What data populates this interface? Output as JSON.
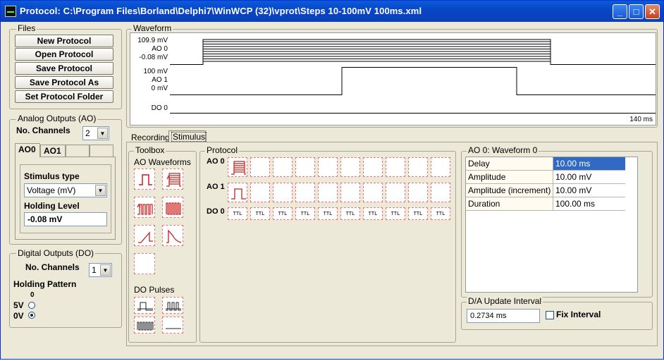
{
  "title": "Protocol: C:\\Program Files\\Borland\\Delphi7\\WinWCP (32)\\vprot\\Steps 10-100mV 100ms.xml",
  "window_buttons": {
    "minimize": "_",
    "maximize": "□",
    "close": "✕"
  },
  "files": {
    "legend": "Files",
    "buttons": [
      "New Protocol",
      "Open Protocol",
      "Save Protocol",
      "Save Protocol As",
      "Set Protocol Folder"
    ]
  },
  "analog": {
    "legend": "Analog Outputs (AO)",
    "nchannels_label": "No. Channels",
    "nchannels_value": "2",
    "tabs": [
      "AO0",
      "AO1",
      "",
      ""
    ],
    "stimulus_type_label": "Stimulus type",
    "stimulus_type_value": "Voltage (mV)",
    "holding_label": "Holding Level",
    "holding_value": "-0.08 mV"
  },
  "digital": {
    "legend": "Digital Outputs (DO)",
    "nchannels_label": "No. Channels",
    "nchannels_value": "1",
    "holding_label": "Holding Pattern",
    "bit_label": "0",
    "high_label": "5V",
    "low_label": "0V",
    "selected": "0V"
  },
  "waveform": {
    "legend": "Waveform",
    "ao0_labels": [
      "109.9 mV",
      "AO 0",
      "-0.08 mV"
    ],
    "ao1_labels": [
      "100 mV",
      "AO 1",
      "0 mV"
    ],
    "do0_label": "DO 0",
    "time_label": "140 ms"
  },
  "page_tabs": {
    "recording": "Recording",
    "stimulus": "Stimulus"
  },
  "toolbox": {
    "legend": "Toolbox",
    "ao_title": "AO Waveforms",
    "do_title": "DO Pulses",
    "ao_icons": [
      "step-pulse-icon",
      "step-family-icon",
      "pulse-train-icon",
      "pulse-train-dense-icon",
      "ramp-icon",
      "ap-waveform-icon",
      "blank-waveform-icon"
    ],
    "do_icons": [
      "ttl-pulse-icon",
      "ttl-train-icon",
      "ttl-dense-train-icon",
      "ttl-blank-icon"
    ]
  },
  "protocol": {
    "legend": "Protocol",
    "rows": [
      "AO 0",
      "AO 1",
      "DO 0"
    ],
    "ttl_text": "TTL"
  },
  "properties": {
    "legend": "AO 0: Waveform 0",
    "rows": [
      {
        "key": "Delay",
        "value": "10.00 ms"
      },
      {
        "key": "Amplitude",
        "value": "10.00 mV"
      },
      {
        "key": "Amplitude (increment)",
        "value": "10.00 mV"
      },
      {
        "key": "Duration",
        "value": "100.00 ms"
      }
    ]
  },
  "da_update": {
    "legend": "D/A Update Interval",
    "value": "0.2734 ms",
    "fix_label": "Fix Interval"
  },
  "colors": {
    "titlebar": "#0846c6",
    "selection": "#316ac5",
    "icon_red": "#c8201c"
  }
}
